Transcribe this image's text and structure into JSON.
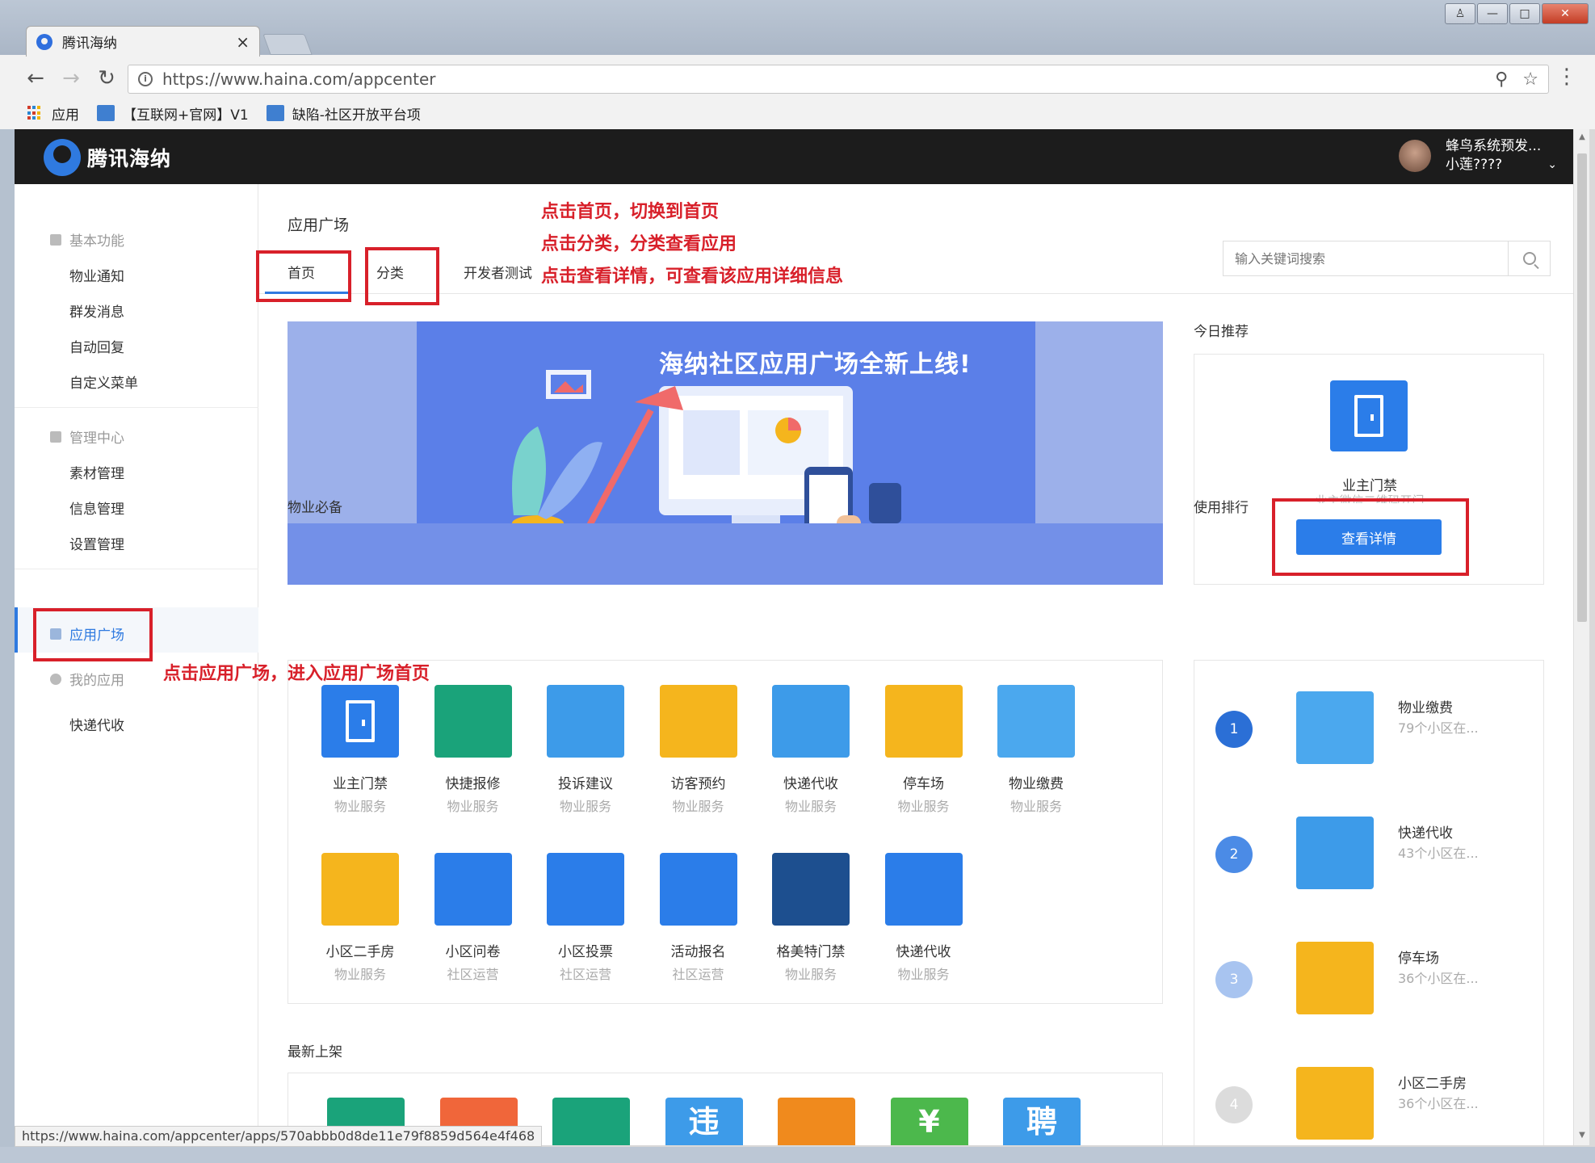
{
  "browser": {
    "tab_title": "腾讯海纳",
    "tab_close": "×",
    "url": "https://www.haina.com/appcenter",
    "bookmarks": [
      "应用",
      "【互联网+官网】V1",
      "缺陷-社区开放平台项"
    ],
    "status_url": "https://www.haina.com/appcenter/apps/570abbb0d8de11e79f8859d564e4f468"
  },
  "header": {
    "logo_text": "腾讯海纳",
    "user_line1": "蜂鸟系统预发...",
    "user_line2": "小莲????"
  },
  "sidebar": {
    "group1": "基本功能",
    "group1_items": [
      "物业通知",
      "群发消息",
      "自动回复",
      "自定义菜单"
    ],
    "group2": "管理中心",
    "group2_items": [
      "素材管理",
      "信息管理",
      "设置管理"
    ],
    "active": "应用广场",
    "group3": "我的应用",
    "group3_items": [
      "快递代收"
    ]
  },
  "main": {
    "title": "应用广场",
    "tabs": [
      "首页",
      "分类",
      "开发者测试"
    ],
    "search_placeholder": "输入关键词搜索",
    "banner_title": "海纳社区应用广场全新上线!",
    "section_essentials": "物业必备",
    "section_new": "最新上架",
    "apps": [
      {
        "name": "业主门禁",
        "cat": "物业服务",
        "color": "#2b7de9"
      },
      {
        "name": "快捷报修",
        "cat": "物业服务",
        "color": "#1aa37a"
      },
      {
        "name": "投诉建议",
        "cat": "物业服务",
        "color": "#3d9be9"
      },
      {
        "name": "访客预约",
        "cat": "物业服务",
        "color": "#f5b51d"
      },
      {
        "name": "快递代收",
        "cat": "物业服务",
        "color": "#3d9be9"
      },
      {
        "name": "停车场",
        "cat": "物业服务",
        "color": "#f5b51d"
      },
      {
        "name": "物业缴费",
        "cat": "物业服务",
        "color": "#4ba8ee"
      },
      {
        "name": "小区二手房",
        "cat": "物业服务",
        "color": "#f5b51d"
      },
      {
        "name": "小区问卷",
        "cat": "社区运营",
        "color": "#2b7de9"
      },
      {
        "name": "小区投票",
        "cat": "社区运营",
        "color": "#2b7de9"
      },
      {
        "name": "活动报名",
        "cat": "社区运营",
        "color": "#2b7de9"
      },
      {
        "name": "格美特门禁",
        "cat": "物业服务",
        "color": "#1d4f8f"
      },
      {
        "name": "快递代收",
        "cat": "物业服务",
        "color": "#2b7de9"
      }
    ],
    "new_icon_colors": [
      "#1aa37a",
      "#f0663a",
      "#1aa37a",
      "#3d9be9",
      "#f08a1d",
      "#4cb84c",
      "#3d9be9"
    ],
    "new_icon_glyphs": [
      "",
      "",
      "",
      "违",
      "",
      "¥",
      "聘"
    ]
  },
  "right": {
    "today_label": "今日推荐",
    "rec_name": "业主门禁",
    "rec_desc": "业主微信二维码开门",
    "rec_button": "查看详情",
    "ranking_label": "使用排行",
    "ranking": [
      {
        "rank": "1",
        "name": "物业缴费",
        "sub": "79个小区在...",
        "num_color": "#2b6fd6",
        "icon_color": "#4ba8ee"
      },
      {
        "rank": "2",
        "name": "快递代收",
        "sub": "43个小区在...",
        "num_color": "#4b8be6",
        "icon_color": "#3d9be9"
      },
      {
        "rank": "3",
        "name": "停车场",
        "sub": "36个小区在...",
        "num_color": "#a8c4f0",
        "icon_color": "#f5b51d"
      },
      {
        "rank": "4",
        "name": "小区二手房",
        "sub": "36个小区在...",
        "num_color": "#dcdcdc",
        "icon_color": "#f5b51d"
      }
    ]
  },
  "annotations": {
    "line1": "点击首页，切换到首页",
    "line2": "点击分类，分类查看应用",
    "line3": "点击查看详情，可查看该应用详细信息",
    "line4": "点击应用广场，进入应用广场首页"
  }
}
